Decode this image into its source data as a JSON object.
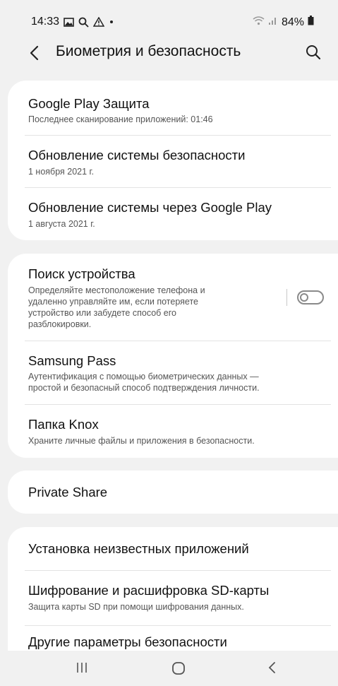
{
  "status_bar": {
    "time": "14:33",
    "battery": "84%"
  },
  "app_bar": {
    "title": "Биометрия и безопасность"
  },
  "items": [
    {
      "title": "Google Play Защита",
      "subtitle": "Последнее сканирование приложений: 01:46"
    },
    {
      "title": "Обновление системы безопасности",
      "subtitle": "1 ноября 2021 г."
    },
    {
      "title": "Обновление системы через Google Play",
      "subtitle": "1 августа 2021 г."
    },
    {
      "title": "Поиск устройства",
      "subtitle_lines": [
        "Определяйте местоположение телефона и",
        "удаленно управляйте им, если потеряете",
        "устройство или забудете способ его",
        "разблокировки."
      ],
      "toggle_on": false
    },
    {
      "title": "Samsung Pass",
      "subtitle_lines": [
        "Аутентификация с помощью биометрических данных —",
        "простой и безопасный способ подтверждения личности."
      ]
    },
    {
      "title": "Папка Knox",
      "subtitle": "Храните личные файлы и приложения в безопасности."
    },
    {
      "title": "Private Share"
    },
    {
      "title": "Установка неизвестных приложений"
    },
    {
      "title": "Шифрование и расшифровка SD-карты",
      "subtitle": "Защита карты SD при помощи шифрования данных."
    },
    {
      "title": "Другие параметры безопасности"
    }
  ],
  "nav_bar": {
    "recents_glyph": "|||",
    "home_glyph": "○",
    "back_glyph": "<"
  },
  "colors": {
    "background": "#f1f1f1",
    "card": "#ffffff",
    "toggle": "#8a8a8a"
  }
}
